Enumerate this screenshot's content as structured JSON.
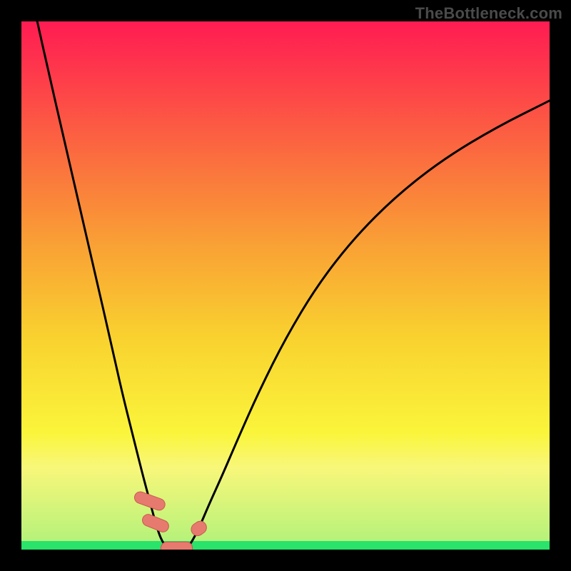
{
  "watermark": "TheBottleneck.com",
  "chart_data": {
    "type": "line",
    "title": "",
    "xlabel": "",
    "ylabel": "",
    "xlim": [
      0,
      100
    ],
    "ylim": [
      0,
      100
    ],
    "grid": false,
    "legend": false,
    "series": [
      {
        "name": "left-branch",
        "x": [
          3,
          5,
          8,
          11,
          14,
          17,
          19,
          21,
          23,
          24.3,
          25.4,
          26.4,
          27.4,
          28.0
        ],
        "y": [
          100,
          91,
          78,
          65,
          52,
          39,
          30,
          22,
          14,
          9.2,
          5.0,
          2.0,
          0.5,
          0.0
        ]
      },
      {
        "name": "right-branch",
        "x": [
          31.0,
          32.0,
          33.6,
          35.5,
          38,
          41,
          45,
          50,
          56,
          63,
          71,
          80,
          90,
          100
        ],
        "y": [
          0.0,
          1.0,
          4.0,
          8.5,
          14,
          21,
          30,
          40,
          50,
          59,
          67,
          74,
          80,
          85
        ]
      }
    ],
    "floor_band": {
      "y_start": 0.0,
      "y_end": 1.6,
      "color": "#29E36B"
    },
    "near_floor_band": {
      "y_start": 1.6,
      "y_end": 15,
      "gradient": [
        "#B6F27A",
        "#F8F77A"
      ]
    },
    "markers": [
      {
        "shape": "capsule",
        "cx": 24.3,
        "cy": 9.2,
        "w": 2.2,
        "h": 6.0,
        "angle": -70,
        "color": "#E77A6F"
      },
      {
        "shape": "capsule",
        "cx": 25.4,
        "cy": 5.0,
        "w": 2.2,
        "h": 5.2,
        "angle": -68,
        "color": "#E77A6F"
      },
      {
        "shape": "capsule",
        "cx": 29.4,
        "cy": 0.25,
        "w": 6.0,
        "h": 2.4,
        "angle": 0,
        "color": "#E77A6F"
      },
      {
        "shape": "capsule",
        "cx": 33.6,
        "cy": 4.0,
        "w": 2.4,
        "h": 3.0,
        "angle": 55,
        "color": "#E77A6F"
      }
    ],
    "background_gradient": {
      "stops": [
        {
          "offset": 0.0,
          "color": "#FF1C52"
        },
        {
          "offset": 0.1,
          "color": "#FE3A4B"
        },
        {
          "offset": 0.25,
          "color": "#FB6B3F"
        },
        {
          "offset": 0.42,
          "color": "#F9A035"
        },
        {
          "offset": 0.6,
          "color": "#F9D22F"
        },
        {
          "offset": 0.78,
          "color": "#FAF53B"
        },
        {
          "offset": 0.845,
          "color": "#F8F77A"
        },
        {
          "offset": 0.984,
          "color": "#B6F27A"
        },
        {
          "offset": 0.984001,
          "color": "#29E36B"
        },
        {
          "offset": 1.0,
          "color": "#29E36B"
        }
      ]
    }
  }
}
